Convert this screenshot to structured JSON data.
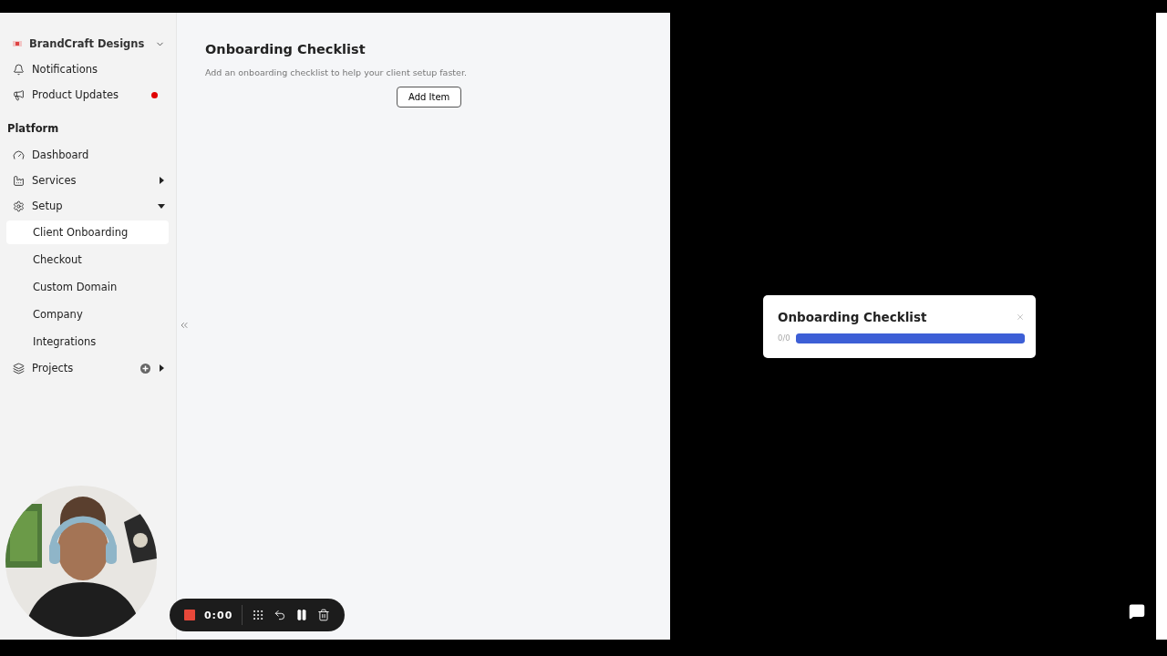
{
  "workspace": {
    "name": "BrandCraft Designs"
  },
  "top_items": [
    {
      "label": "Notifications",
      "unread": false
    },
    {
      "label": "Product Updates",
      "unread": true
    }
  ],
  "section": "Platform",
  "nav": [
    {
      "label": "Dashboard",
      "kind": "link"
    },
    {
      "label": "Services",
      "kind": "group",
      "expanded": false
    },
    {
      "label": "Setup",
      "kind": "group",
      "expanded": true,
      "children": [
        {
          "label": "Client Onboarding",
          "selected": true
        },
        {
          "label": "Checkout",
          "selected": false
        },
        {
          "label": "Custom Domain",
          "selected": false
        },
        {
          "label": "Company",
          "selected": false
        },
        {
          "label": "Integrations",
          "selected": false
        }
      ]
    },
    {
      "label": "Projects",
      "kind": "group_add",
      "expanded": false
    }
  ],
  "page": {
    "title": "Onboarding Checklist",
    "subtitle": "Add an onboarding checklist to help your client setup faster.",
    "button": "Add Item"
  },
  "preview": {
    "title": "Onboarding Checklist",
    "count": "0/0",
    "level": 1
  },
  "recorder": {
    "timer": "0:00"
  }
}
